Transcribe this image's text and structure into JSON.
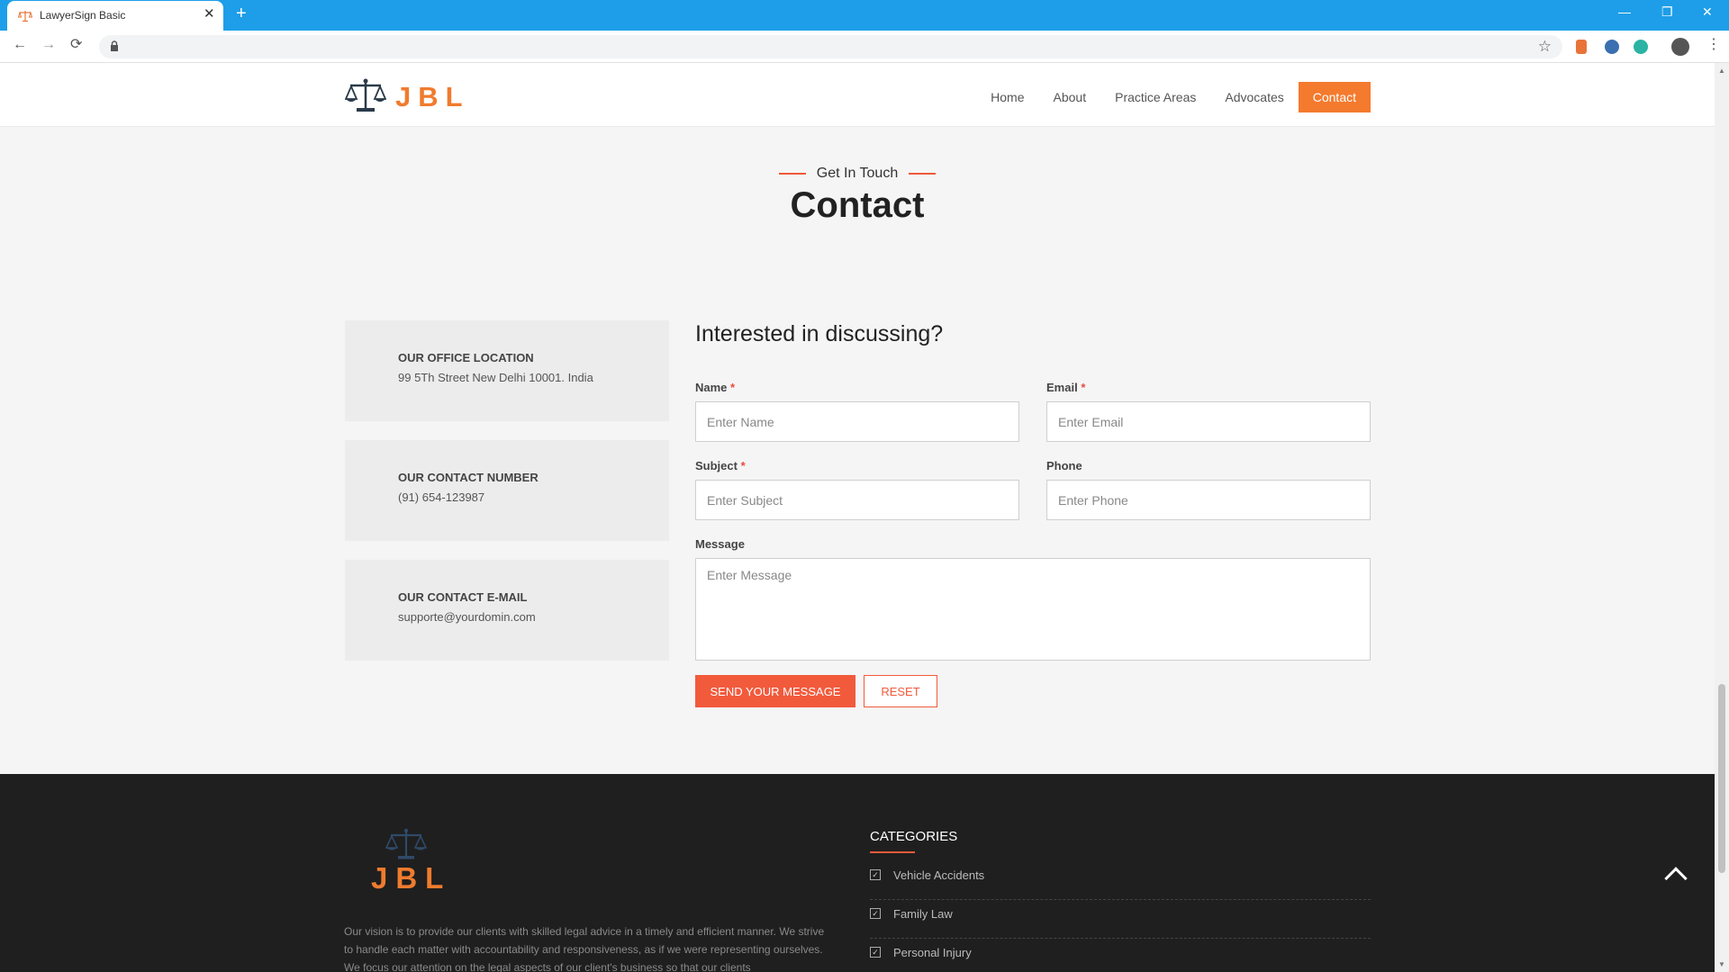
{
  "browser": {
    "tab_title": "LawyerSign Basic",
    "tab_close": "✕",
    "new_tab": "+",
    "minimize": "—",
    "restore": "❐",
    "close": "✕",
    "back": "←",
    "forward": "→",
    "reload": "⟳",
    "bookmark": "☆",
    "menu": "⋮"
  },
  "header": {
    "logo_text": "JBL",
    "nav": [
      {
        "label": "Home"
      },
      {
        "label": "About"
      },
      {
        "label": "Practice Areas"
      },
      {
        "label": "Advocates"
      },
      {
        "label": "Contact"
      }
    ],
    "active_nav": "Contact",
    "accent_color": "#f47a2e"
  },
  "section": {
    "eyebrow": "Get In Touch",
    "title": "Contact"
  },
  "info_cards": [
    {
      "label": "OUR OFFICE LOCATION",
      "value": "99 5Th Street New Delhi 10001. India"
    },
    {
      "label": "OUR CONTACT NUMBER",
      "value": "(91) 654-123987"
    },
    {
      "label": "OUR CONTACT E-MAIL",
      "value": "supporte@yourdomin.com"
    }
  ],
  "form": {
    "title": "Interested in discussing?",
    "name": {
      "label": "Name",
      "required": "*",
      "placeholder": "Enter Name",
      "value": ""
    },
    "email": {
      "label": "Email",
      "required": "*",
      "placeholder": "Enter Email",
      "value": ""
    },
    "subject": {
      "label": "Subject",
      "required": "*",
      "placeholder": "Enter Subject",
      "value": ""
    },
    "phone": {
      "label": "Phone",
      "placeholder": "Enter Phone",
      "value": ""
    },
    "message": {
      "label": "Message",
      "placeholder": "Enter Message",
      "value": ""
    },
    "send_label": "SEND YOUR MESSAGE",
    "reset_label": "RESET",
    "button_color": "#f25a3c"
  },
  "footer": {
    "logo_text": "JBL",
    "about_text": "Our vision is to provide our clients with skilled legal advice in a timely and efficient manner. We strive to handle each matter with accountability and responsiveness, as if we were representing ourselves. We focus our attention on the legal aspects of our client's business so that our clients",
    "categories_title": "CATEGORIES",
    "categories": [
      {
        "label": "Vehicle Accidents"
      },
      {
        "label": "Family Law"
      },
      {
        "label": "Personal Injury"
      }
    ],
    "check_glyph": "✓"
  }
}
